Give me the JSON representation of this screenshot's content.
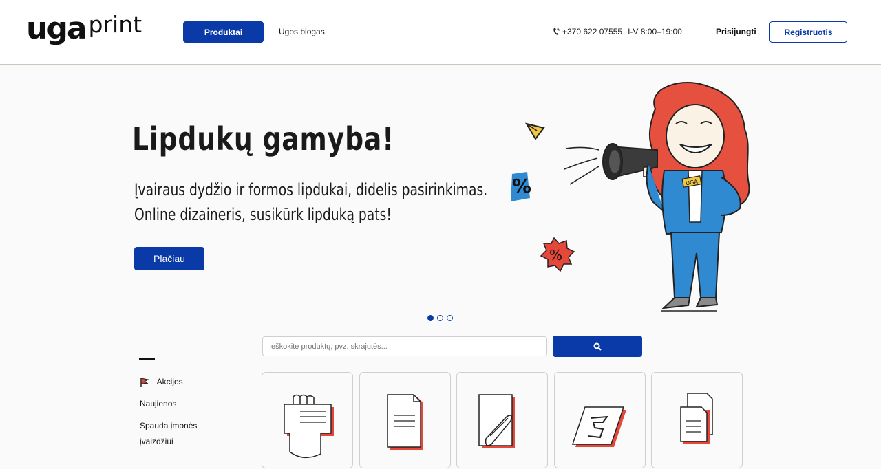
{
  "header": {
    "logo_main": "uga",
    "logo_sub": "print",
    "nav_products": "Produktai",
    "nav_blog": "Ugos blogas",
    "phone": "+370 622 07555",
    "hours": "I-V 8:00–19:00",
    "login": "Prisijungti",
    "register": "Registruotis"
  },
  "hero": {
    "title": "Lipdukų gamyba!",
    "subtitle_line1": "Įvairaus dydžio ir formos lipdukai, didelis pasirinkimas.",
    "subtitle_line2": "Online dizaineris, susikūrk lipduką pats!",
    "button": "Plačiau",
    "badge_text": "UGA",
    "percent_symbol": "%",
    "slides": 3,
    "active_slide": 1
  },
  "search": {
    "placeholder": "Ieškokite produktų, pvz. skrajutės..."
  },
  "sidebar": {
    "items": [
      {
        "label": "Akcijos"
      },
      {
        "label": "Naujienos"
      },
      {
        "label": "Spauda įmonės"
      },
      {
        "label": "įvaizdžiui"
      }
    ]
  },
  "colors": {
    "brand_blue": "#0a3aa8",
    "accent_red": "#e5483a",
    "hair_red": "#e6513f",
    "light_blue": "#2f8ad2"
  },
  "icons": {
    "phone": "phone-icon",
    "search": "search-icon",
    "flag": "flag-icon"
  }
}
